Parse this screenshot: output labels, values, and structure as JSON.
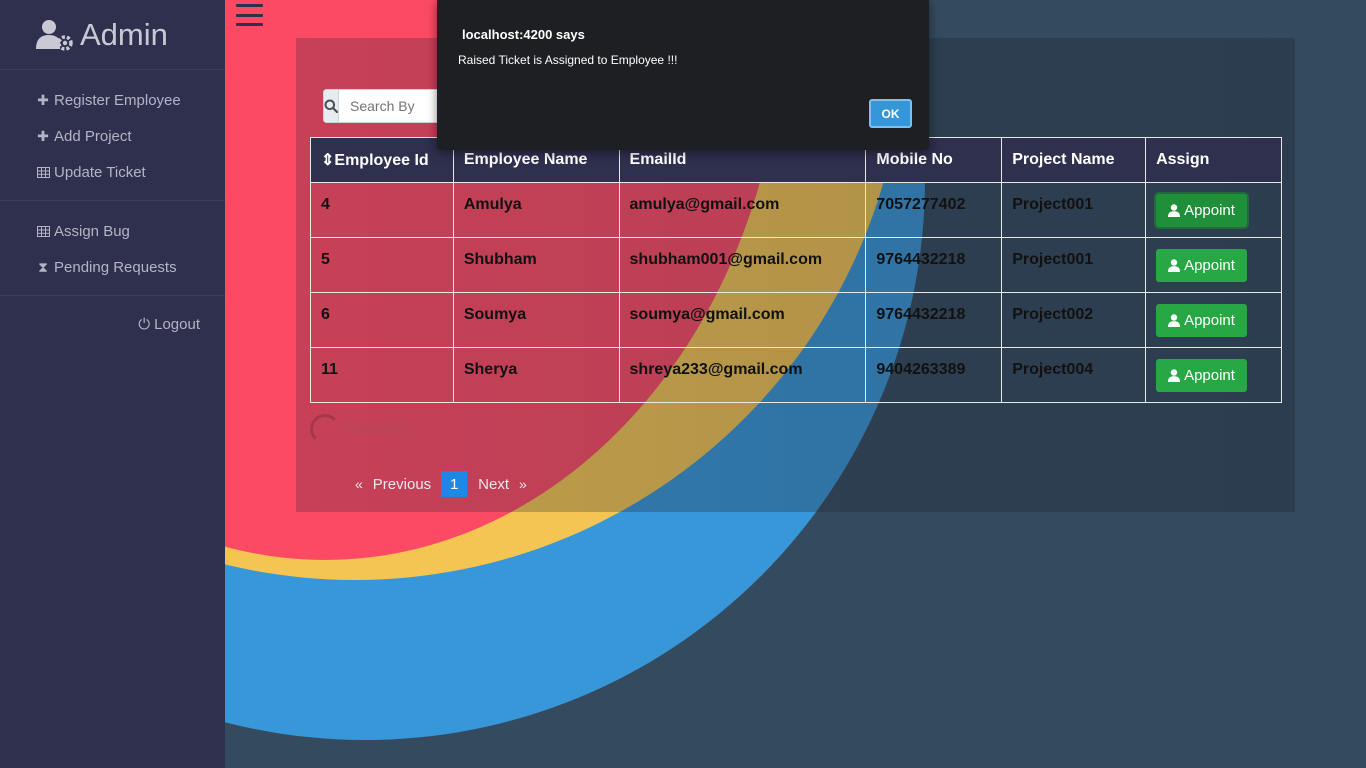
{
  "sidebar": {
    "brand": "Admin",
    "group1": [
      {
        "label": "Register Employee",
        "icon": "plus-icon"
      },
      {
        "label": "Add Project",
        "icon": "plus-icon"
      },
      {
        "label": "Update Ticket",
        "icon": "table-icon"
      }
    ],
    "group2": [
      {
        "label": "Assign Bug",
        "icon": "table-icon"
      },
      {
        "label": "Pending Requests",
        "icon": "hourglass-icon"
      }
    ],
    "logout": "Logout"
  },
  "search": {
    "placeholder": "Search By"
  },
  "table": {
    "headers": [
      "Employee Id",
      "Employee Name",
      "EmailId",
      "Mobile No",
      "Project Name",
      "Assign"
    ],
    "rows": [
      {
        "id": "4",
        "name": "Amulya",
        "email": "amulya@gmail.com",
        "mobile": "7057277402",
        "project": "Project001",
        "action": "Appoint"
      },
      {
        "id": "5",
        "name": "Shubham",
        "email": "shubham001@gmail.com",
        "mobile": "9764432218",
        "project": "Project001",
        "action": "Appoint"
      },
      {
        "id": "6",
        "name": "Soumya",
        "email": "soumya@gmail.com",
        "mobile": "9764432218",
        "project": "Project002",
        "action": "Appoint"
      },
      {
        "id": "11",
        "name": "Sherya",
        "email": "shreya233@gmail.com",
        "mobile": "9404263389",
        "project": "Project004",
        "action": "Appoint"
      }
    ]
  },
  "loading": "Loading...",
  "pagination": {
    "prev_arrow": "«",
    "prev": "Previous",
    "current": "1",
    "next": "Next",
    "next_arrow": "»"
  },
  "dialog": {
    "title": "localhost:4200 says",
    "message": "Raised Ticket is Assigned to Employee !!!",
    "ok": "OK"
  },
  "colors": {
    "sidebar": "#2f2f4e",
    "accent_blue": "#3897d8",
    "accent_red": "#fd4a64",
    "accent_yellow": "#f4c552",
    "button_green": "#28a745"
  }
}
